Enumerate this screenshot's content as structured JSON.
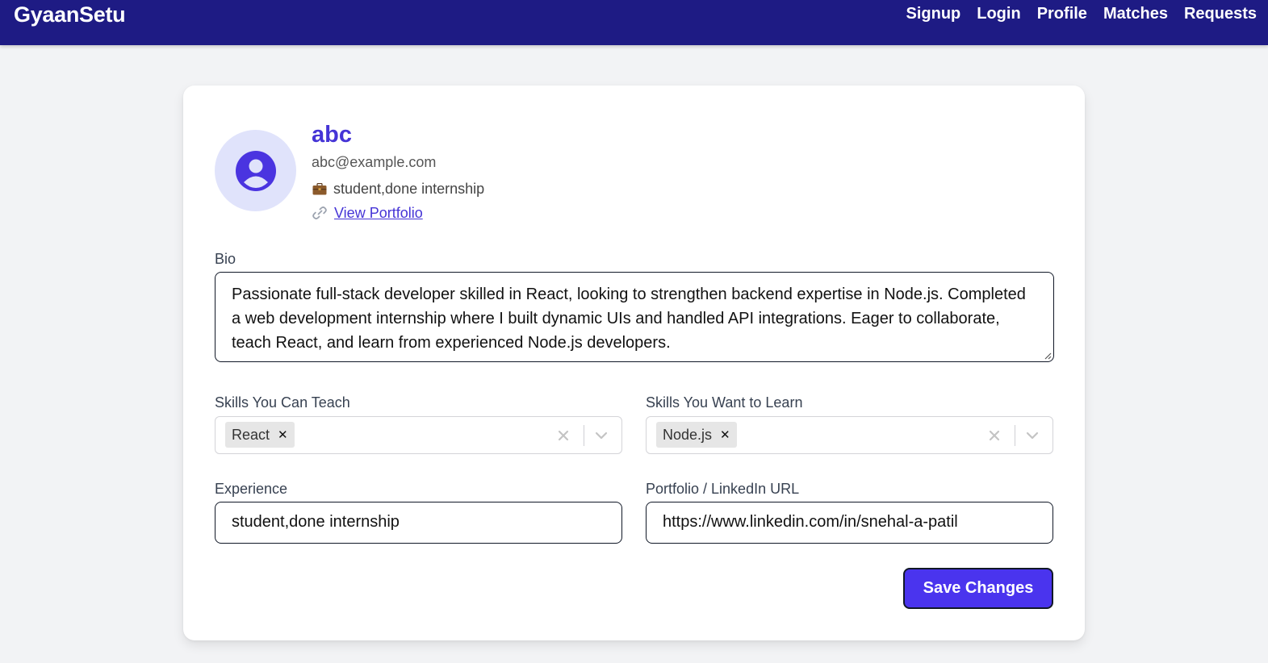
{
  "nav": {
    "brand": "GyaanSetu",
    "links": [
      "Signup",
      "Login",
      "Profile",
      "Matches",
      "Requests"
    ]
  },
  "profile": {
    "name": "abc",
    "email": "abc@example.com",
    "experience": "student,done internship",
    "portfolio_link_label": "View Portfolio",
    "avatar_icon": "user-circle-icon"
  },
  "form": {
    "bio_label": "Bio",
    "bio_value": "Passionate full-stack developer skilled in React, looking to strengthen backend expertise in Node.js. Completed a web development internship where I built dynamic UIs and handled API integrations. Eager to collaborate, teach React, and learn from experienced Node.js developers.",
    "teach_label": "Skills You Can Teach",
    "teach_skills": [
      "React"
    ],
    "learn_label": "Skills You Want to Learn",
    "learn_skills": [
      "Node.js"
    ],
    "experience_label": "Experience",
    "experience_value": "student,done internship",
    "portfolio_label": "Portfolio / LinkedIn URL",
    "portfolio_value": "https://www.linkedin.com/in/snehal-a-patil",
    "save_label": "Save Changes"
  },
  "colors": {
    "nav_bg": "#1e1b84",
    "accent": "#4534d6",
    "button_bg": "#4a34ee",
    "avatar_bg": "#e0e3fb"
  }
}
